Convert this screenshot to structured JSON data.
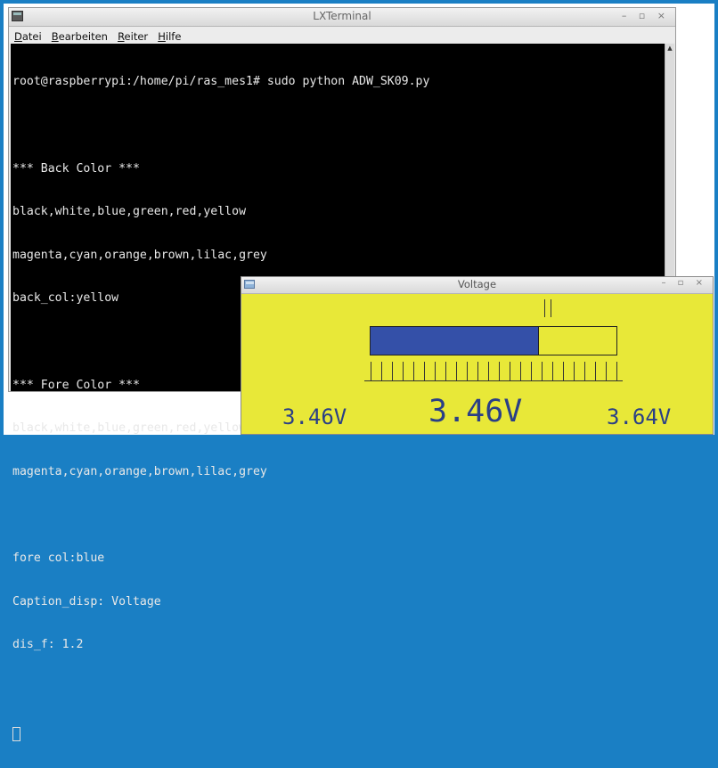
{
  "terminal": {
    "title": "LXTerminal",
    "controls": "– ▫ ×",
    "menu": [
      {
        "underline": "D",
        "rest": "atei"
      },
      {
        "underline": "B",
        "rest": "earbeiten"
      },
      {
        "underline": "R",
        "rest": "eiter"
      },
      {
        "underline": "H",
        "rest": "ilfe"
      }
    ],
    "lines": [
      "root@raspberrypi:/home/pi/ras_mes1# sudo python ADW_SK09.py",
      "",
      "*** Back Color ***",
      "black,white,blue,green,red,yellow",
      "magenta,cyan,orange,brown,lilac,grey",
      "back_col:yellow",
      "",
      "*** Fore Color ***",
      "black,white,blue,green,red,yellow",
      "magenta,cyan,orange,brown,lilac,grey",
      "",
      "fore col:blue",
      "Caption_disp: Voltage",
      "dis_f: 1.2",
      ""
    ]
  },
  "voltage": {
    "title": "Voltage",
    "controls": "– ▫ ×",
    "level_fraction": 0.68,
    "tick_count": 24,
    "min_label": "3.46V",
    "current_label": "3.46V",
    "max_label": "3.64V",
    "colors": {
      "background": "#e8e838",
      "bar": "#3450a8",
      "text": "#2a3f86"
    }
  }
}
